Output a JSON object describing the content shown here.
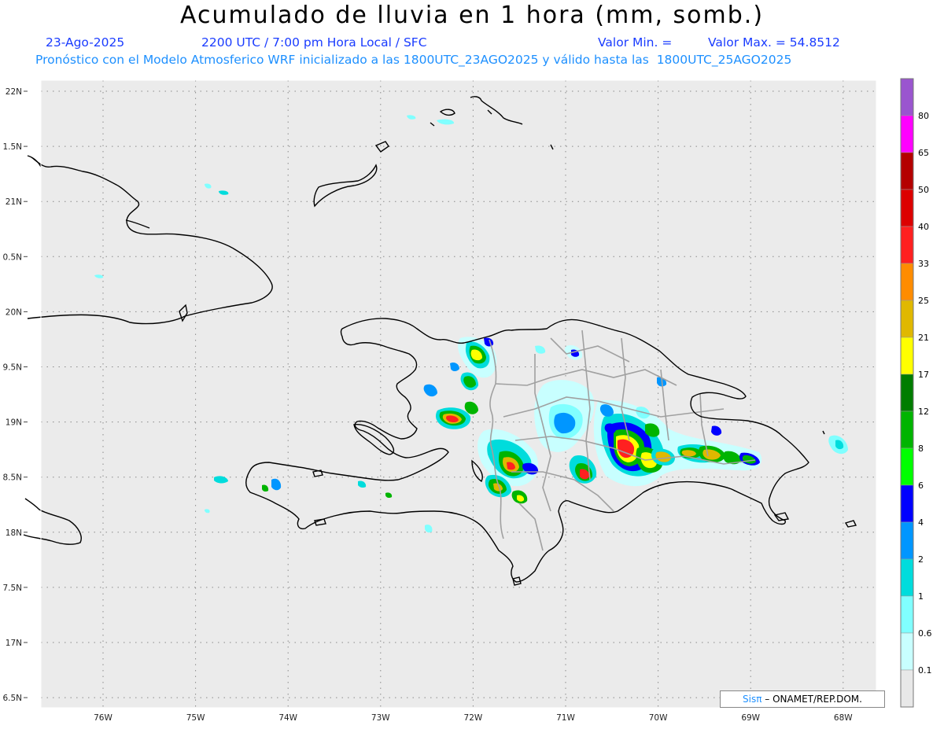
{
  "title": "Acumulado de lluvia en 1 hora (mm, somb.)",
  "header": {
    "date": "23-Ago-2025",
    "time": "2200 UTC / 7:00 pm Hora Local / SFC",
    "valor_min": "Valor Min. =",
    "valor_max": "Valor Max. = 54.8512",
    "model_line": "Pronóstico con el Modelo Atmosferico WRF inicializado a las 1800UTC_23AGO2025 y válido hasta las  1800UTC_25AGO2025"
  },
  "map": {
    "lat_labels": [
      "22N",
      "1.5N",
      "21N",
      "0.5N",
      "20N",
      "9.5N",
      "19N",
      "8.5N",
      "18N",
      "7.5N",
      "17N",
      "6.5N"
    ],
    "lon_labels": [
      "76W",
      "75W",
      "74W",
      "73W",
      "72W",
      "71W",
      "70W",
      "69W",
      "68W"
    ],
    "background": "#ebebeb",
    "coastline_color": "#000000",
    "border_color": "#a0a0a0"
  },
  "colorbar": {
    "labels": [
      "80",
      "65",
      "50",
      "40",
      "33",
      "25",
      "21",
      "17",
      "12",
      "8",
      "6",
      "4",
      "2",
      "1",
      "0.6",
      "0.1"
    ],
    "colors": [
      "#9a55cf",
      "#ff00ff",
      "#b40000",
      "#dc0000",
      "#ff2020",
      "#ff8c00",
      "#e0b800",
      "#ffff00",
      "#007d00",
      "#00b400",
      "#00ff00",
      "#0000ff",
      "#0096ff",
      "#00dcdc",
      "#80ffff",
      "#c8ffff",
      "#e8e8e8"
    ]
  },
  "credit": {
    "brand": "Sisπ",
    "text": " – ONAMET/REP.DOM."
  }
}
